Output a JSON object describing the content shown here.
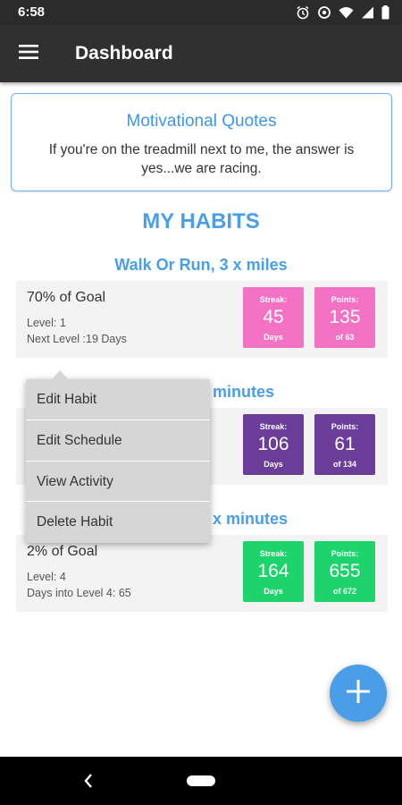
{
  "status_bar": {
    "time": "6:58"
  },
  "app_bar": {
    "title": "Dashboard"
  },
  "quote": {
    "title": "Motivational Quotes",
    "text": "If you're on the treadmill next to me, the answer is yes...we are racing."
  },
  "habits_heading": "MY HABITS",
  "habits": [
    {
      "title": "Walk Or Run, 3 x miles",
      "goal": "70% of Goal",
      "line1": "Level: 1",
      "line2": "Next Level :19 Days",
      "streak": {
        "label": "Streak:",
        "value": "45",
        "sub": "Days",
        "color": "#f472c4"
      },
      "points": {
        "label": "Points:",
        "value": "135",
        "sub": "of 63",
        "color": "#f472c4"
      }
    },
    {
      "title": "minutes",
      "streak": {
        "label": "Streak:",
        "value": "106",
        "sub": "Days",
        "color": "#6a3d99"
      },
      "points": {
        "label": "Points:",
        "value": "61",
        "sub": "of 134",
        "color": "#6a3d99"
      }
    },
    {
      "title": "x minutes",
      "goal": "2% of Goal",
      "line1": "Level: 4",
      "line2": "Days into Level 4: 65",
      "streak": {
        "label": "Streak:",
        "value": "164",
        "sub": "Days",
        "color": "#1dd36b"
      },
      "points": {
        "label": "Points:",
        "value": "655",
        "sub": "of 672",
        "color": "#1dd36b"
      }
    }
  ],
  "popup_menu": {
    "items": [
      "Edit Habit",
      "Edit Schedule",
      "View Activity",
      "Delete Habit"
    ]
  },
  "fab": {
    "icon": "plus-icon",
    "color": "#4a9ee8"
  },
  "nav_bar": {
    "back_icon": "back-chevron-icon",
    "home_icon": "home-pill-icon"
  }
}
